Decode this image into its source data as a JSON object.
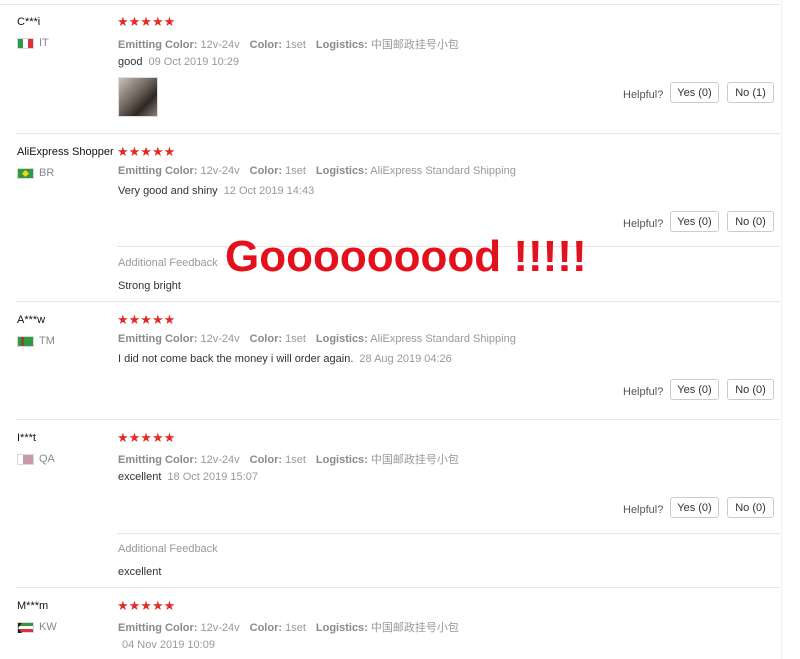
{
  "labels": {
    "emitting_color": "Emitting Color:",
    "color": "Color:",
    "logistics": "Logistics:",
    "helpful": "Helpful?",
    "additional_feedback": "Additional Feedback"
  },
  "stars": "★★★★★",
  "overlay_text": "Gooooooood !!!!!",
  "colors": {
    "star": "#e02b27",
    "overlay": "#e4101b"
  },
  "reviews": [
    {
      "user": "C***i",
      "country": "IT",
      "flag": "flag-it-icon",
      "emitting_color": "12v-24v",
      "color": "1set",
      "logistics": "中国邮政挂号小包",
      "text": "good",
      "date": "09 Oct 2019 10:29",
      "yes": "Yes (0)",
      "no": "No (1)",
      "has_photo": true
    },
    {
      "user": "AliExpress Shopper",
      "country": "BR",
      "flag": "flag-br-icon",
      "emitting_color": "12v-24v",
      "color": "1set",
      "logistics": "AliExpress Standard Shipping",
      "text": "Very good and shiny",
      "date": "12 Oct 2019 14:43",
      "yes": "Yes (0)",
      "no": "No (0)",
      "additional_feedback": "Strong bright"
    },
    {
      "user": "A***w",
      "country": "TM",
      "flag": "flag-tm-icon",
      "emitting_color": "12v-24v",
      "color": "1set",
      "logistics": "AliExpress Standard Shipping",
      "text": "I did not come back the money i will order again.",
      "date": "28 Aug 2019 04:26",
      "yes": "Yes (0)",
      "no": "No (0)"
    },
    {
      "user": "I***t",
      "country": "QA",
      "flag": "flag-qa-icon",
      "emitting_color": "12v-24v",
      "color": "1set",
      "logistics": "中国邮政挂号小包",
      "text": "excellent",
      "date": "18 Oct 2019 15:07",
      "yes": "Yes (0)",
      "no": "No (0)",
      "additional_feedback": "excellent"
    },
    {
      "user": "M***m",
      "country": "KW",
      "flag": "flag-kw-icon",
      "emitting_color": "12v-24v",
      "color": "1set",
      "logistics": "中国邮政挂号小包",
      "text": "",
      "date": "04 Nov 2019 10:09"
    }
  ]
}
